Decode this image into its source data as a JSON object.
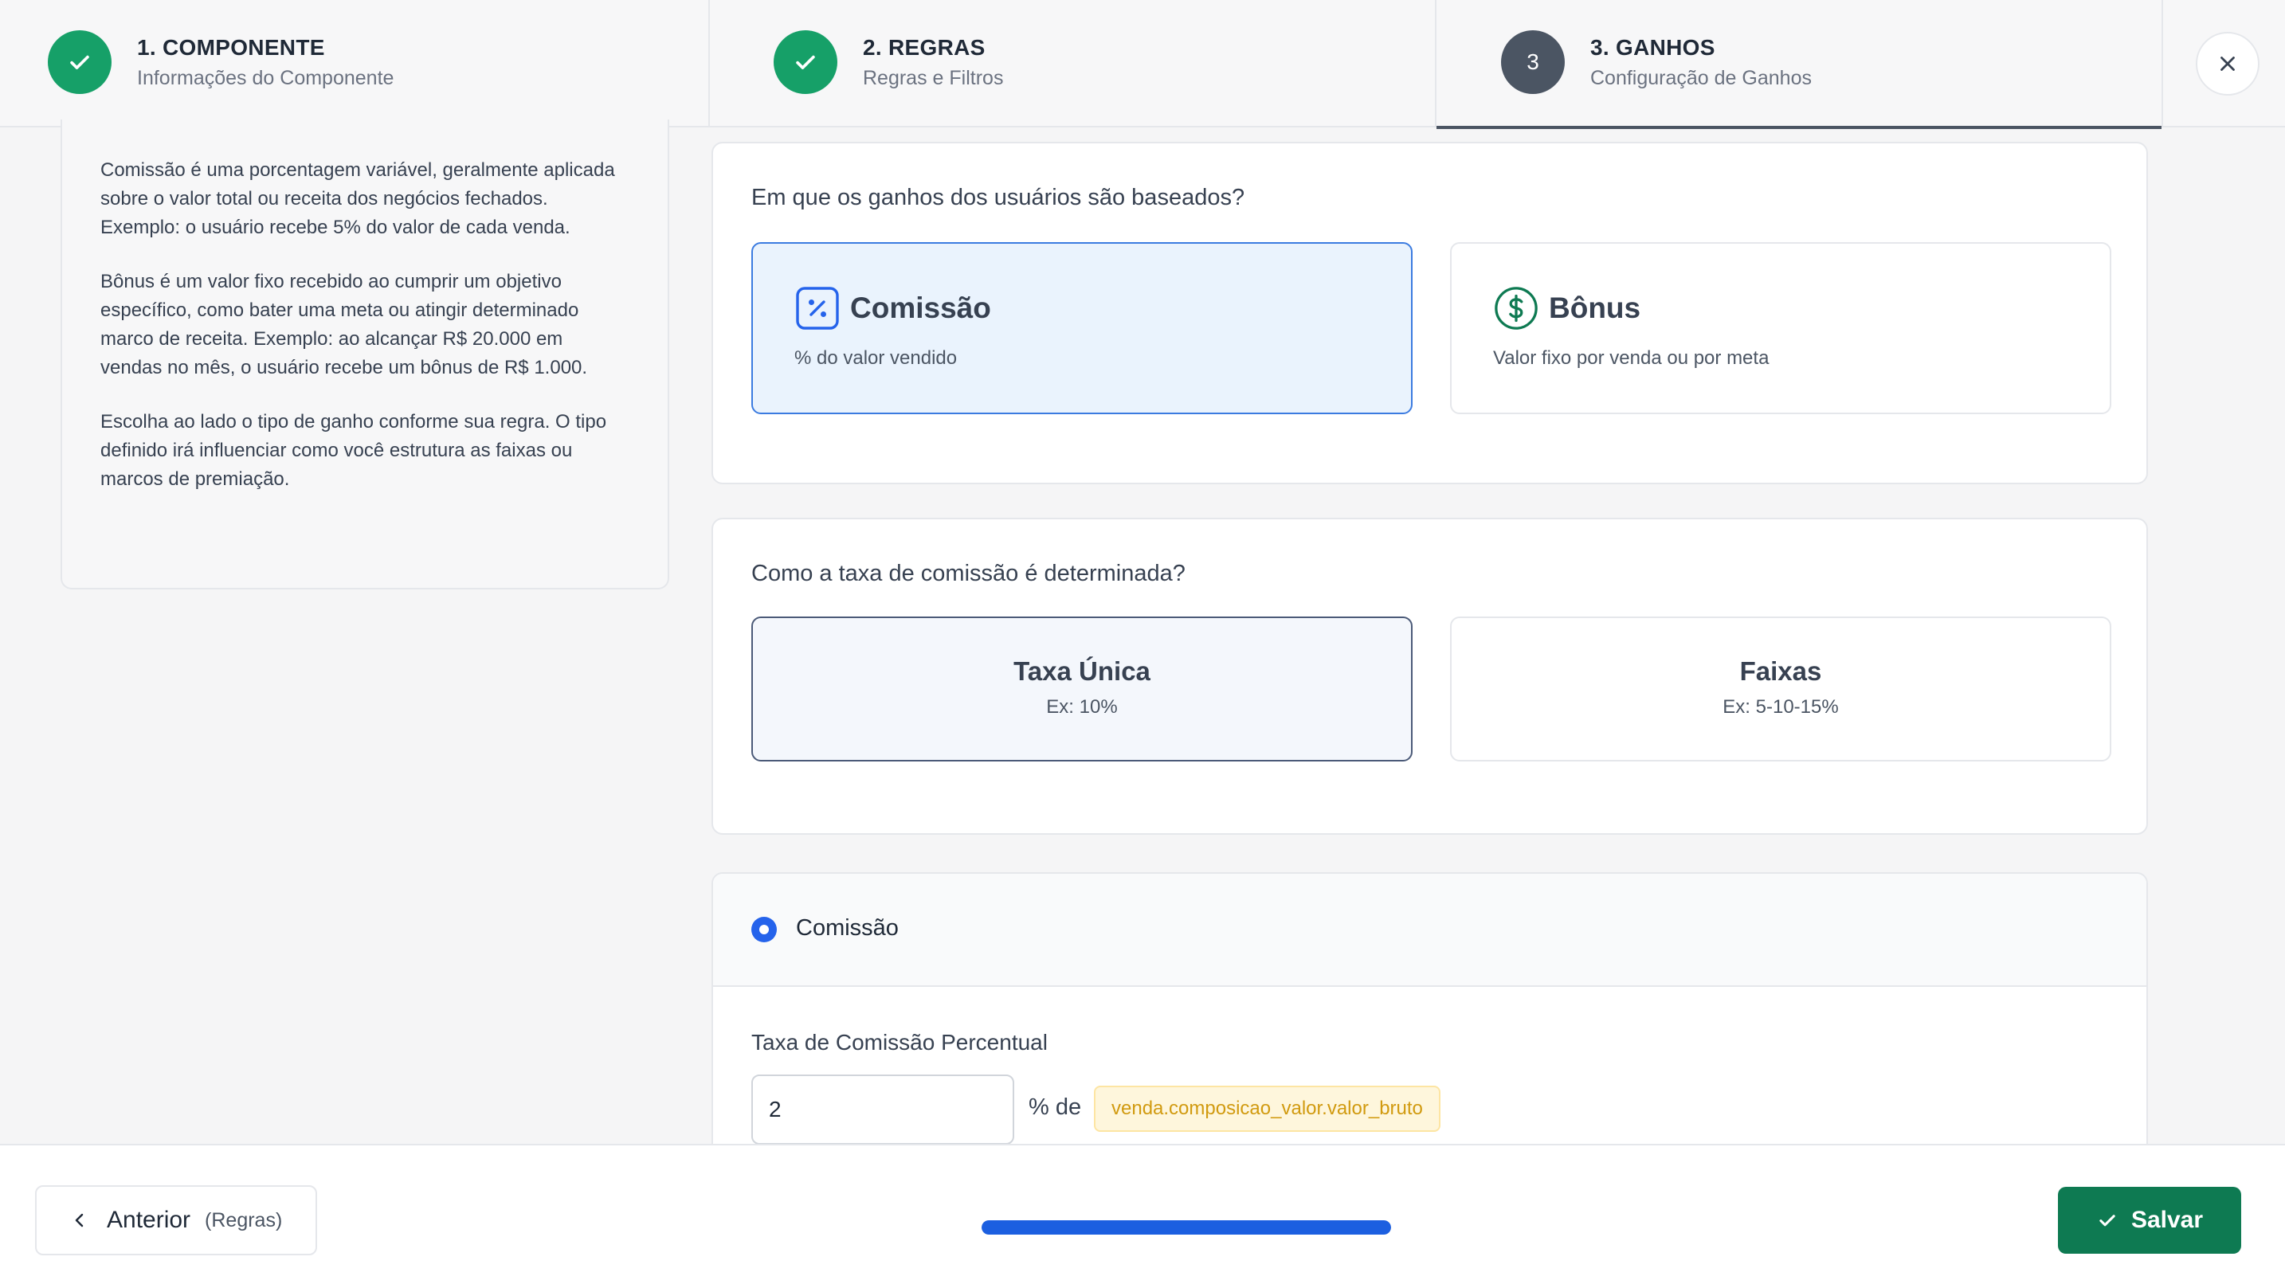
{
  "colors": {
    "done": "#16a068",
    "active_step": "#4b5563",
    "primary_blue": "#2563eb",
    "save_green": "#0e7a52",
    "chip_text": "#d19a0f"
  },
  "stepper": {
    "steps": [
      {
        "title": "1. COMPONENTE",
        "subtitle": "Informações do Componente",
        "status": "done",
        "icon": "check-icon"
      },
      {
        "title": "2. REGRAS",
        "subtitle": "Regras e Filtros",
        "status": "done",
        "icon": "check-icon"
      },
      {
        "title": "3. GANHOS",
        "subtitle": "Configuração de Ganhos",
        "status": "active",
        "number": "3"
      }
    ],
    "close_icon": "close-icon"
  },
  "info": {
    "paragraphs": [
      "Comissão é uma porcentagem variável, geralmente aplicada sobre o valor total ou receita dos negócios fechados. Exemplo: o usuário recebe 5% do valor de cada venda.",
      "Bônus é um valor fixo recebido ao cumprir um objetivo específico, como bater uma meta ou atingir determinado marco de receita. Exemplo: ao alcançar R$ 20.000 em vendas no mês, o usuário recebe um bônus de R$ 1.000.",
      "Escolha ao lado o tipo de ganho conforme sua regra. O tipo definido irá influenciar como você estrutura as faixas ou marcos de premiação."
    ]
  },
  "earnings_basis": {
    "question": "Em que os ganhos dos usuários são baseados?",
    "options": [
      {
        "title": "Comissão",
        "desc": "% do valor vendido",
        "icon": "percent-icon",
        "selected": true
      },
      {
        "title": "Bônus",
        "desc": "Valor fixo por venda ou por meta",
        "icon": "dollar-icon",
        "selected": false
      }
    ]
  },
  "rate_mode": {
    "question": "Como a taxa de comissão é determinada?",
    "options": [
      {
        "title": "Taxa Única",
        "example": "Ex: 10%",
        "selected": true
      },
      {
        "title": "Faixas",
        "example": "Ex: 5-10-15%",
        "selected": false
      }
    ]
  },
  "commission": {
    "header": "Comissão",
    "rate_label": "Taxa de Comissão Percentual",
    "rate_value": "2",
    "pct_of": "% de",
    "field": "venda.composicao_valor.valor_bruto"
  },
  "footer": {
    "back_label": "Anterior",
    "back_sub": "(Regras)",
    "progress": 1.0,
    "save_label": "Salvar"
  }
}
